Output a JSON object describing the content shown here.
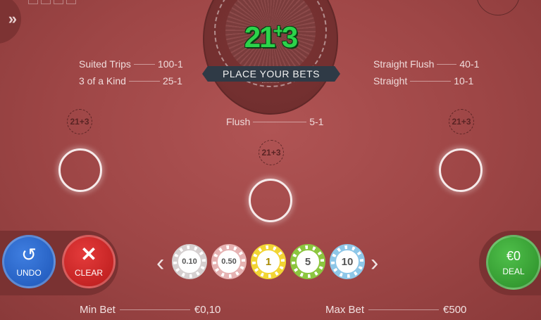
{
  "logo": {
    "left": "21",
    "plus": "+",
    "right": "3"
  },
  "banner": "PLACE YOUR BETS",
  "payouts_left": [
    {
      "name": "Suited Trips",
      "odds": "100-1"
    },
    {
      "name": "3 of a Kind",
      "odds": "25-1"
    }
  ],
  "payouts_right": [
    {
      "name": "Straight Flush",
      "odds": "40-1"
    },
    {
      "name": "Straight",
      "odds": "10-1"
    }
  ],
  "payout_center": {
    "name": "Flush",
    "odds": "5-1"
  },
  "spot_tag": "21+3",
  "controls": {
    "undo": "UNDO",
    "clear": "CLEAR",
    "deal_amount": "€0",
    "deal": "DEAL"
  },
  "chips": [
    {
      "label": "0.10",
      "color": "#d6d0d0"
    },
    {
      "label": "0.50",
      "color": "#e6b2b2"
    },
    {
      "label": "1",
      "color": "#f2d534"
    },
    {
      "label": "5",
      "color": "#8cc63f"
    },
    {
      "label": "10",
      "color": "#8ec7e8"
    }
  ],
  "limits": {
    "min_label": "Min Bet",
    "min_value": "€0,10",
    "max_label": "Max Bet",
    "max_value": "€500"
  }
}
